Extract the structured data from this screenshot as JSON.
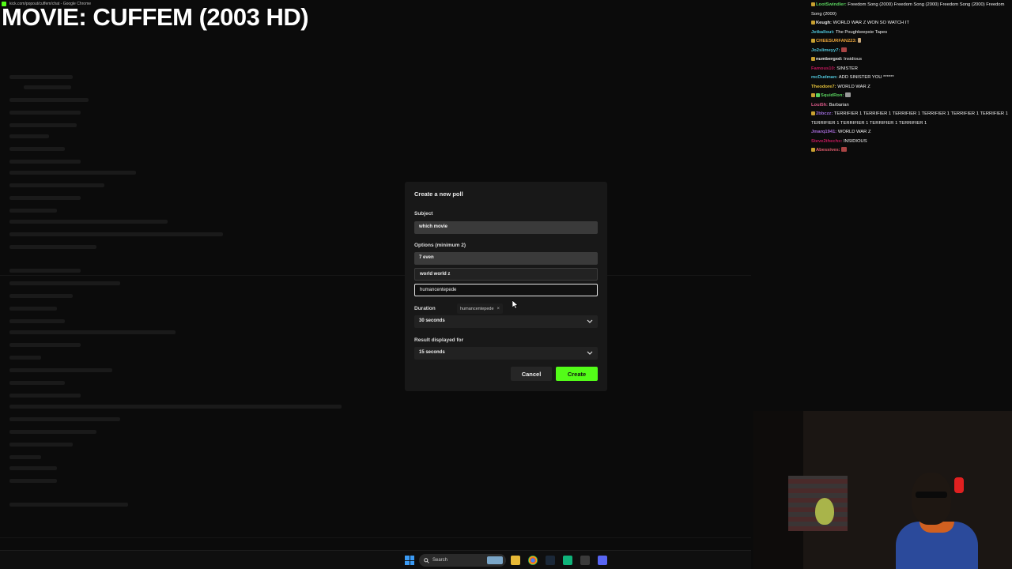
{
  "browser": {
    "url_title": "kick.com/popout/cuffem/chat - Google Chrome"
  },
  "overlay": {
    "title": "MOVIE: CUFFEM (2003 HD)"
  },
  "poll": {
    "title": "Create a new poll",
    "subject_label": "Subject",
    "subject_value": "which movie",
    "options_label": "Options (minimum 2)",
    "options": [
      "7 even",
      "world world z",
      "humancentepede"
    ],
    "autocomplete_suggestion": "humancentepede",
    "duration_label": "Duration",
    "duration_value": "30 seconds",
    "result_label": "Result displayed for",
    "result_value": "15 seconds",
    "cancel_label": "Cancel",
    "create_label": "Create"
  },
  "chat": {
    "messages": [
      {
        "user": "LootSwindler:",
        "text": "Freedom Song (2000)   Freedom Song (2000)   Freedom Song (2000)   Freedom Song (2000)",
        "color": "#59d15e"
      },
      {
        "user": "Keugh:",
        "text": "WORLD WAR Z WON SO WATCH IT",
        "color": "#e8e8e8"
      },
      {
        "user": "Jetballout:",
        "text": "The Poughkeepsie Tapes",
        "color": "#4fc3d8"
      },
      {
        "user": "CHEESURFAN223:",
        "text": "",
        "color": "#e8a33a"
      },
      {
        "user": "Jo2slimeyy7:",
        "text": "",
        "color": "#4fc3d8"
      },
      {
        "user": "numbergxd:",
        "text": "Insidious",
        "color": "#e8e8e8"
      },
      {
        "user": "Famous10:",
        "text": "SINISTER",
        "color": "#c2185b"
      },
      {
        "user": "mcDudman:",
        "text": "ADD SINISTER YOU ******",
        "color": "#4fc3d8"
      },
      {
        "user": "Theodore7:",
        "text": "WORLD WAR Z",
        "color": "#e8c43a"
      },
      {
        "user": "SquidRon:",
        "text": "",
        "color": "#59d15e"
      },
      {
        "user": "Loui5h:",
        "text": "Barbarian",
        "color": "#e05b8c"
      },
      {
        "user": "2bbczz:",
        "text": "TERRIFIER 1 TERRIFIER 1 TERRIFIER 1 TERRIFIER 1 TERRIFIER 1 TERRIFIER 1 TERRIFIER 1 TERRIFIER 1 TERRIFIER 1 TERRIFIER 1",
        "color": "#9b6bd8"
      },
      {
        "user": "Jmarq1941:",
        "text": "WORLD WAR Z",
        "color": "#a66bd8"
      },
      {
        "user": "Steve2thechx:",
        "text": "INSIDIOUS",
        "color": "#c2185b"
      },
      {
        "user": "Abessives:",
        "text": "",
        "color": "#e05b6c"
      }
    ]
  },
  "taskbar": {
    "search_label": "Search"
  },
  "colors": {
    "accent": "#53fc18",
    "modal_bg": "#181818",
    "page_bg": "#0b0b0b"
  }
}
